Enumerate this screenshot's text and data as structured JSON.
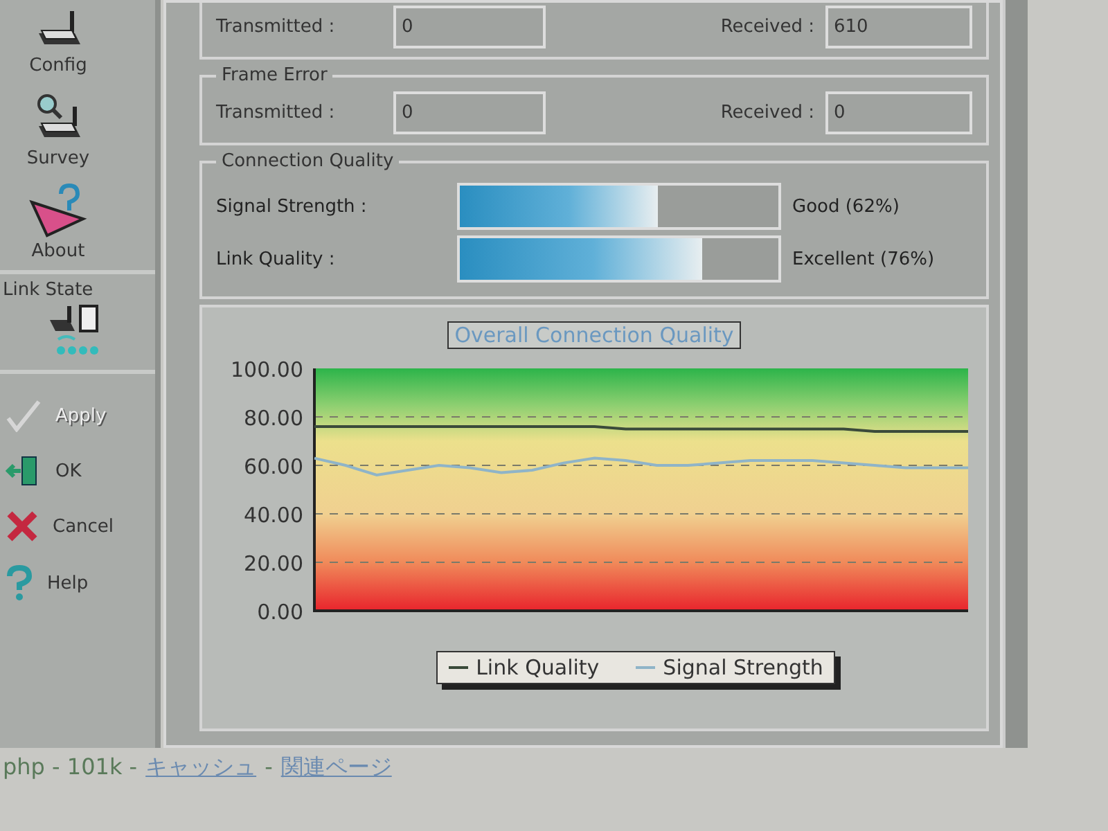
{
  "sidebar": {
    "nav": [
      {
        "label": "Config"
      },
      {
        "label": "Survey"
      },
      {
        "label": "About"
      }
    ],
    "link_state": {
      "title": "Link State"
    },
    "actions": [
      {
        "label": "Apply",
        "disabled": true
      },
      {
        "label": "OK",
        "disabled": false
      },
      {
        "label": "Cancel",
        "disabled": false
      },
      {
        "label": "Help",
        "disabled": false
      }
    ]
  },
  "packet_counts": {
    "fields": [
      {
        "label": "Transmitted :",
        "value": "0"
      },
      {
        "label": "Received :",
        "value": "610"
      }
    ]
  },
  "frame_error": {
    "title": "Frame Error",
    "fields": [
      {
        "label": "Transmitted :",
        "value": "0"
      },
      {
        "label": "Received :",
        "value": "0"
      }
    ]
  },
  "connection_quality": {
    "title": "Connection Quality",
    "meters": [
      {
        "label": "Signal Strength :",
        "level": 0.62,
        "reading": "Good (62%)"
      },
      {
        "label": "Link Quality :",
        "level": 0.76,
        "reading": "Excellent (76%)"
      }
    ]
  },
  "chart_panel": {
    "chart_data": {
      "type": "line",
      "title": "Overall Connection Quality",
      "grid": true,
      "legend": true,
      "ylim": [
        0,
        100
      ],
      "yticks": [
        {
          "value": 0,
          "label": "0.00"
        },
        {
          "value": 20,
          "label": "20.00"
        },
        {
          "value": 40,
          "label": "40.00"
        },
        {
          "value": 60,
          "label": "60.00"
        },
        {
          "value": 80,
          "label": "80.00"
        },
        {
          "value": 100,
          "label": "100.00"
        }
      ],
      "series": [
        {
          "name": "Link Quality",
          "color": "#3a4a3a",
          "values": [
            76,
            76,
            76,
            76,
            76,
            76,
            76,
            76,
            76,
            76,
            75,
            75,
            75,
            75,
            75,
            75,
            75,
            75,
            74,
            74,
            74,
            74
          ]
        },
        {
          "name": "Signal Strength",
          "color": "#8fb4c8",
          "values": [
            63,
            60,
            56,
            58,
            60,
            59,
            57,
            58,
            61,
            63,
            62,
            60,
            60,
            61,
            62,
            62,
            62,
            61,
            60,
            59,
            59,
            59
          ]
        }
      ]
    }
  },
  "footer": {
    "parts": [
      {
        "kind": "text",
        "text": "php - 101k -"
      },
      {
        "kind": "link",
        "text": "キャッシュ"
      },
      {
        "kind": "text",
        "text": "-"
      },
      {
        "kind": "link",
        "text": "関連ページ"
      }
    ]
  }
}
